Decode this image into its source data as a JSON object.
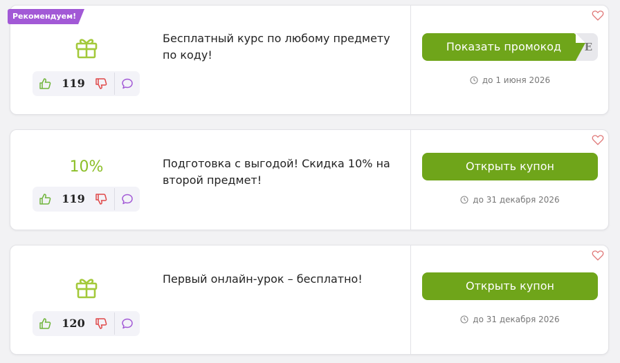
{
  "colors": {
    "accent_green": "#6fa51a",
    "badge_purple": "#a259d6",
    "percent_green": "#8cbf28"
  },
  "offers": [
    {
      "badge": "Рекомендуем!",
      "icon": "gift-icon",
      "votes": "119",
      "description": "Бесплатный курс по любому предмету по коду!",
      "button": "Показать промокод",
      "promo_hint": "E",
      "date": "до 1 июня 2026"
    },
    {
      "percent": "10%",
      "votes": "119",
      "description": "Подготовка с выгодой! Скидка 10% на второй предмет!",
      "button": "Открыть купон",
      "date": "до 31 декабря 2026"
    },
    {
      "icon": "gift-icon",
      "votes": "120",
      "description": "Первый онлайн-урок – бесплатно!",
      "button": "Открыть купон",
      "date": "до 31 декабря 2026"
    }
  ]
}
